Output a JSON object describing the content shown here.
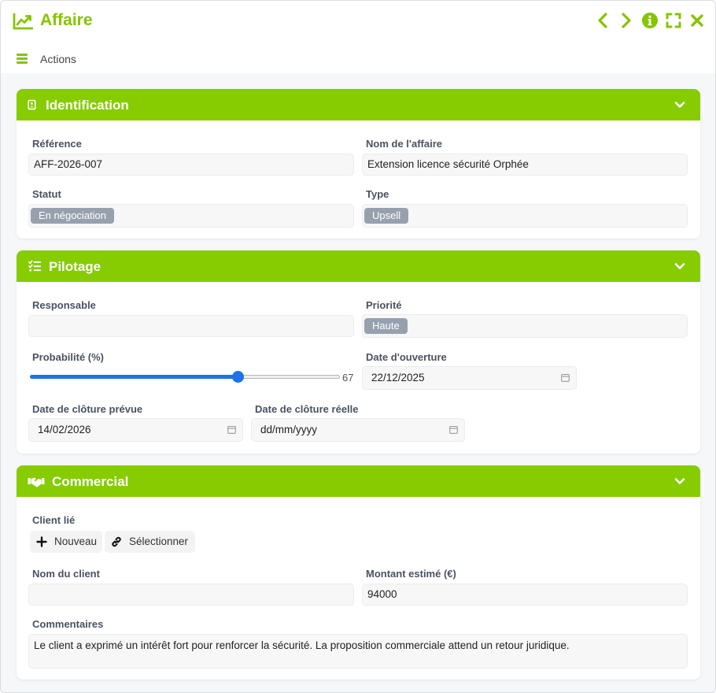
{
  "window": {
    "title": "Affaire",
    "actions_label": "Actions",
    "accent": "#86c400",
    "header_color": "#86cc00"
  },
  "sections": {
    "identification": {
      "title": "Identification",
      "reference_label": "Référence",
      "reference_value": "AFF-2026-007",
      "nom_label": "Nom de l'affaire",
      "nom_value": "Extension licence sécurité Orphée",
      "statut_label": "Statut",
      "statut_value": "En négociation",
      "type_label": "Type",
      "type_value": "Upsell"
    },
    "pilotage": {
      "title": "Pilotage",
      "responsable_label": "Responsable",
      "responsable_value": "",
      "priorite_label": "Priorité",
      "priorite_value": "Haute",
      "probabilite_label": "Probabilité (%)",
      "probabilite_value": 67,
      "probabilite_display": "67",
      "date_ouverture_label": "Date d'ouverture",
      "date_ouverture_value": "22/12/2025",
      "cloture_prevue_label": "Date de clôture prévue",
      "cloture_prevue_value": "14/02/2026",
      "cloture_reelle_label": "Date de clôture réelle",
      "cloture_reelle_value": "dd/mm/yyyy"
    },
    "commercial": {
      "title": "Commercial",
      "client_lie_label": "Client lié",
      "nouveau_label": "Nouveau",
      "selectionner_label": "Sélectionner",
      "nom_client_label": "Nom du client",
      "nom_client_value": "",
      "montant_label": "Montant estimé (€)",
      "montant_value": "94000",
      "commentaires_label": "Commentaires",
      "commentaires_value": "Le client a exprimé un intérêt fort pour renforcer la sécurité. La proposition commerciale attend un retour juridique."
    }
  },
  "icons": {
    "title": "chart-line-icon",
    "prev": "chevron-left-icon",
    "next": "chevron-right-icon",
    "info": "info-circle-icon",
    "maximize": "expand-icon",
    "close": "close-icon",
    "menu": "hamburger-icon",
    "identification": "id-badge-icon",
    "pilotage": "list-check-icon",
    "commercial": "handshake-icon",
    "collapse": "chevron-down-icon",
    "calendar": "calendar-icon",
    "plus": "plus-icon",
    "link": "link-icon"
  }
}
